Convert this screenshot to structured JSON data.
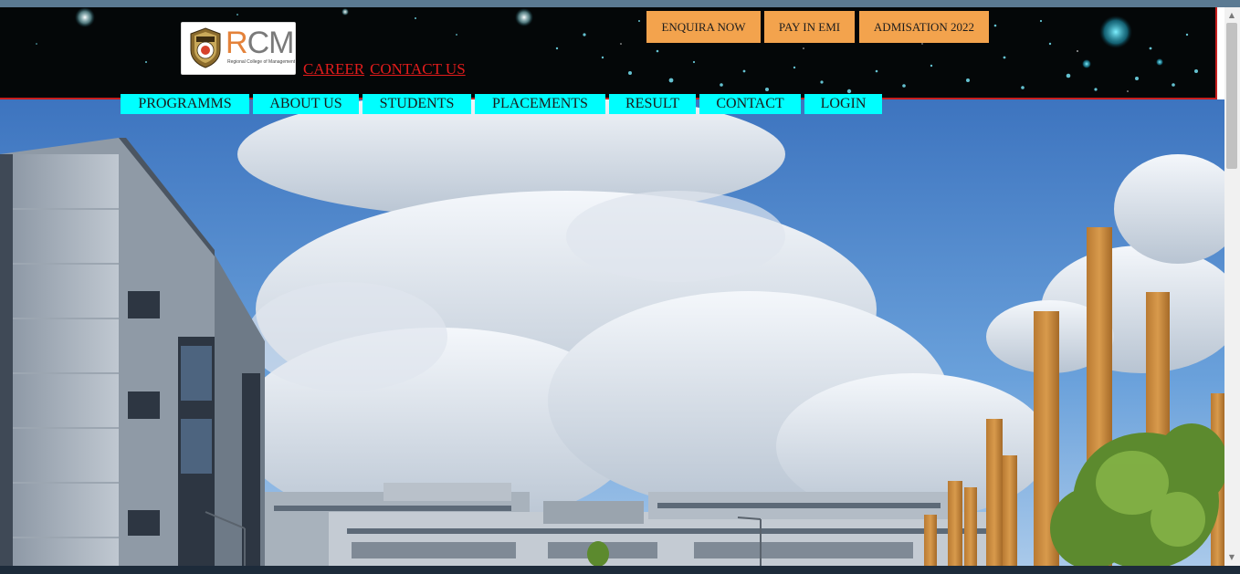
{
  "logo": {
    "text_r": "R",
    "text_cm": "CM",
    "emblem_text": "RCM",
    "tagline": "Regional College of Management"
  },
  "header_links": [
    "CAREER",
    "CONTACT US"
  ],
  "cta_buttons": [
    "ENQUIRA NOW",
    "PAY IN EMI",
    "ADMISATION 2022"
  ],
  "nav": [
    "PROGRAMMS",
    "ABOUT US",
    "STUDENTS",
    "PLACEMENTS",
    "RESULT",
    "CONTACT",
    "LOGIN"
  ],
  "colors": {
    "header_bg": "#040708",
    "header_border": "#c81e1e",
    "link": "#e21c1c",
    "cta_bg": "#f3a34d",
    "nav_bg": "#00ffff",
    "sky": "#5f95d3"
  },
  "icons": {
    "scroll_up": "▲",
    "scroll_down": "▼"
  }
}
